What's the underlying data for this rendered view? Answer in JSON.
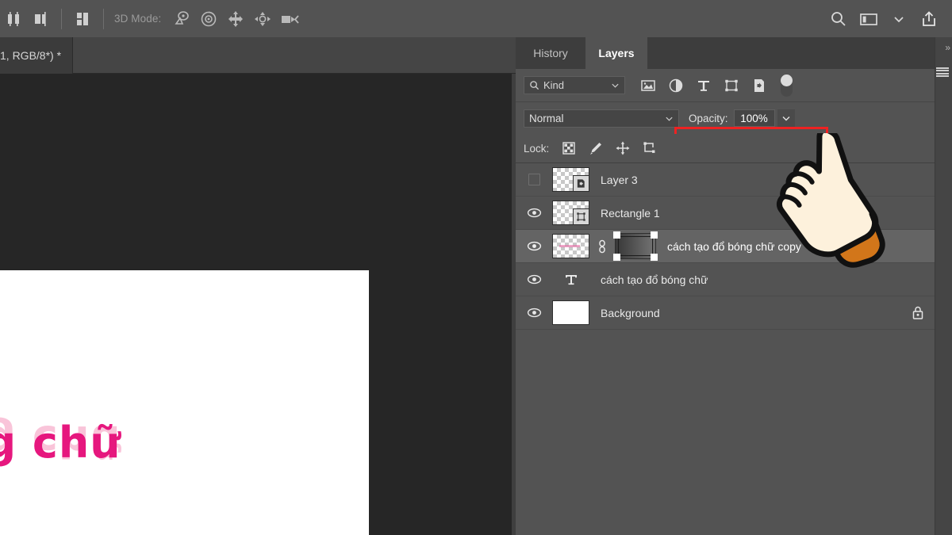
{
  "app": {
    "options_bar": {
      "align_icons": [
        "align-vertical-centers-icon",
        "align-right-edges-icon",
        "distribute-icon"
      ],
      "mode_label": "3D Mode:",
      "mode_icons": [
        "3d-rotate-icon",
        "3d-roll-icon",
        "3d-pan-icon",
        "3d-slide-icon",
        "3d-camera-icon"
      ],
      "right_icons": [
        "search-icon",
        "workspace-panel-icon",
        "chevron-down-icon",
        "share-icon"
      ]
    },
    "document_tab": {
      "title": "1, RGB/8*) *"
    },
    "canvas": {
      "text_main": "ng chữ",
      "text_reflection": "ng chữ",
      "text_color": "#e6177e",
      "reflection_color": "#f7aecb",
      "background_color": "#262626",
      "page_color": "#ffffff"
    }
  },
  "panel": {
    "tabs": [
      {
        "label": "History",
        "active": false
      },
      {
        "label": "Layers",
        "active": true
      }
    ],
    "menu_icon": "panel-menu-icon",
    "expand_icon": "expand-panels-icon",
    "filter": {
      "kind_label": "Kind",
      "search_icon": "search-icon",
      "chevron_icon": "chevron-down-icon",
      "type_icons": [
        "filter-pixel-icon",
        "filter-adjustment-icon",
        "filter-type-icon",
        "filter-shape-icon",
        "filter-smart-object-icon"
      ],
      "toggle_icon": "filter-enable-toggle"
    },
    "blend": {
      "mode_value": "Normal",
      "mode_chevron": "chevron-down-icon",
      "opacity_label": "Opacity:",
      "opacity_value": "100%",
      "opacity_chevron": "chevron-down-icon",
      "highlight_color": "#ee2222"
    },
    "opacity_slider": {
      "value": 100,
      "handle_icon": "slider-handle-icon"
    },
    "lock": {
      "label": "Lock:",
      "icons": [
        "lock-transparent-pixels-icon",
        "lock-image-pixels-icon",
        "lock-position-icon",
        "lock-artboard-nesting-icon"
      ]
    },
    "layers": [
      {
        "name": "Layer 3",
        "visible": false,
        "selected": false,
        "thumb": "checkerboard-smart-object",
        "locked": false,
        "has_mask": false,
        "kind": "raster"
      },
      {
        "name": "Rectangle 1",
        "visible": true,
        "selected": false,
        "thumb": "checkerboard-shape",
        "locked": false,
        "has_mask": false,
        "kind": "shape"
      },
      {
        "name": "cách tạo đổ bóng chữ copy",
        "visible": true,
        "selected": true,
        "thumb": "checkerboard-pixels",
        "locked": false,
        "has_mask": true,
        "kind": "raster"
      },
      {
        "name": "cách tạo đổ bóng chữ",
        "visible": true,
        "selected": false,
        "thumb": "type-T",
        "locked": false,
        "has_mask": false,
        "kind": "type"
      },
      {
        "name": "Background",
        "visible": true,
        "selected": false,
        "thumb": "solid-white",
        "locked": true,
        "has_mask": false,
        "kind": "background"
      }
    ],
    "cursor": {
      "icon": "pointing-hand-cursor",
      "hand_color": "#fdf1dc",
      "cuff_color": "#d2761a"
    }
  }
}
